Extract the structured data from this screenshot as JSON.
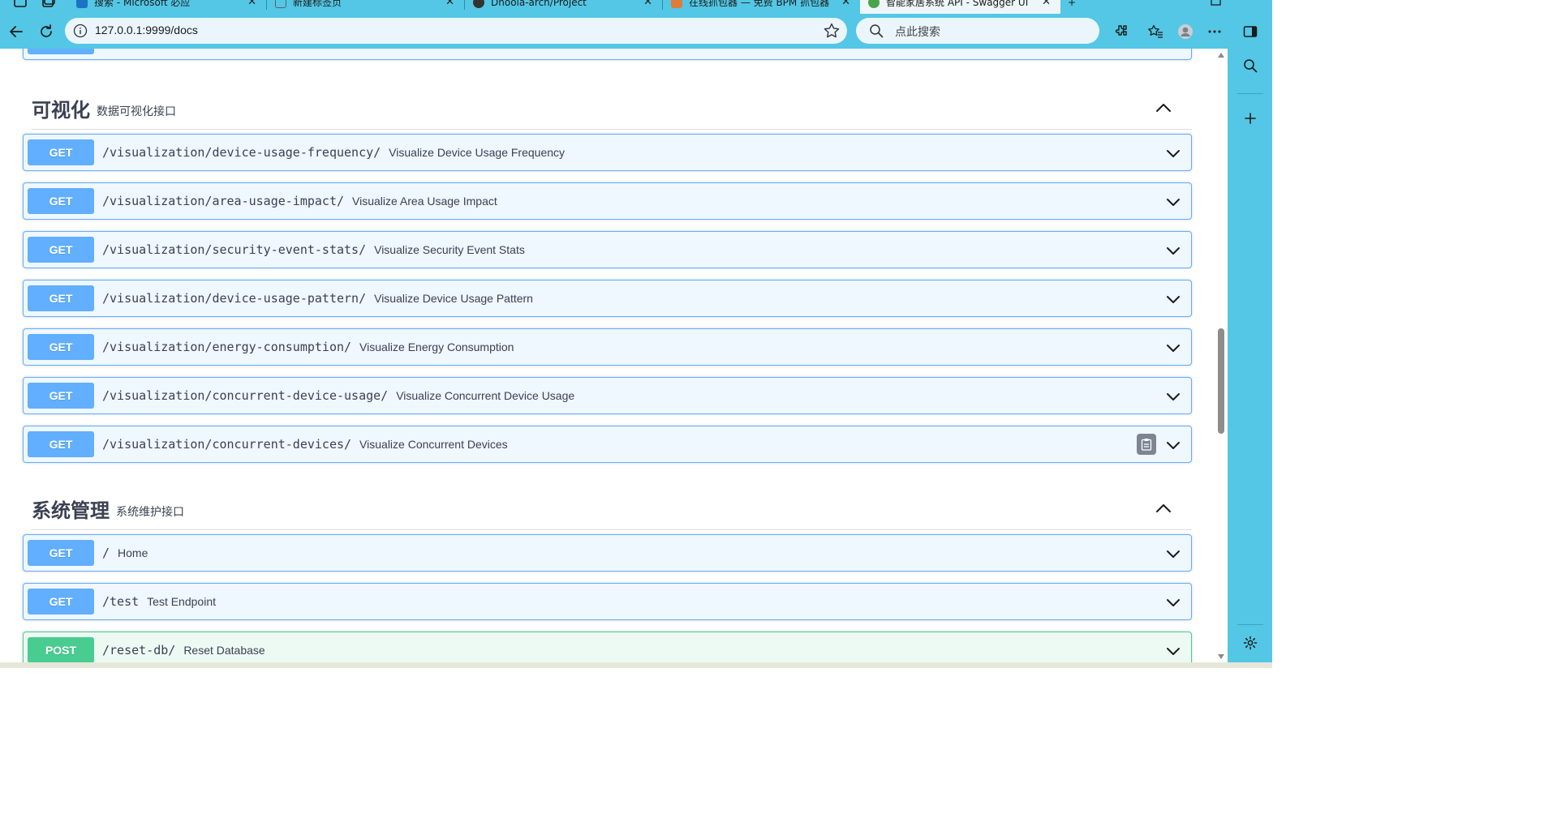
{
  "browser": {
    "tabs": [
      {
        "title": "搜索 - Microsoft 必应",
        "active": false,
        "favicon_color": "#1a73c4"
      },
      {
        "title": "新建标签页",
        "active": false,
        "favicon_color": "#5a6270"
      },
      {
        "title": "Dnoola-arch/Project",
        "active": false,
        "favicon_color": "#333333"
      },
      {
        "title": "在线抓包器 — 免费 BPM 抓包器",
        "active": false,
        "favicon_color": "#e07b3a"
      },
      {
        "title": "智能家居系统 API - Swagger UI",
        "active": true,
        "favicon_color": "#49a34a"
      }
    ],
    "new_tab_label": "+",
    "address": "127.0.0.1:9999/docs",
    "search_placeholder": "点此搜索"
  },
  "sections": [
    {
      "name": "可视化",
      "description": "数据可视化接口",
      "endpoints": [
        {
          "method": "GET",
          "path": "/visualization/device-usage-frequency/",
          "summary": "Visualize Device Usage Frequency"
        },
        {
          "method": "GET",
          "path": "/visualization/area-usage-impact/",
          "summary": "Visualize Area Usage Impact"
        },
        {
          "method": "GET",
          "path": "/visualization/security-event-stats/",
          "summary": "Visualize Security Event Stats"
        },
        {
          "method": "GET",
          "path": "/visualization/device-usage-pattern/",
          "summary": "Visualize Device Usage Pattern"
        },
        {
          "method": "GET",
          "path": "/visualization/energy-consumption/",
          "summary": "Visualize Energy Consumption"
        },
        {
          "method": "GET",
          "path": "/visualization/concurrent-device-usage/",
          "summary": "Visualize Concurrent Device Usage"
        },
        {
          "method": "GET",
          "path": "/visualization/concurrent-devices/",
          "summary": "Visualize Concurrent Devices"
        }
      ]
    },
    {
      "name": "系统管理",
      "description": "系统维护接口",
      "endpoints": [
        {
          "method": "GET",
          "path": "/",
          "summary": "Home"
        },
        {
          "method": "GET",
          "path": "/test",
          "summary": "Test Endpoint"
        },
        {
          "method": "POST",
          "path": "/reset-db/",
          "summary": "Reset Database"
        }
      ]
    }
  ],
  "colors": {
    "browser_chrome": "#53c7e5",
    "get": "#61affe",
    "post": "#49cc90",
    "text": "#3b4151"
  }
}
